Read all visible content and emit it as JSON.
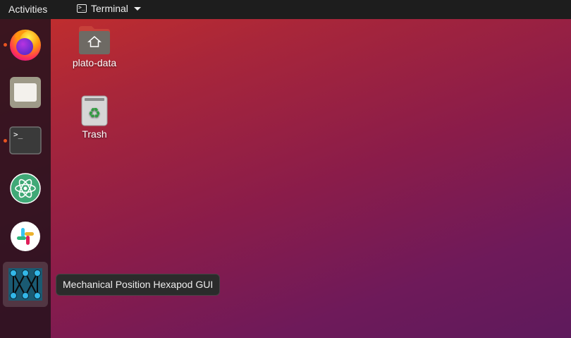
{
  "topbar": {
    "activities_label": "Activities",
    "app_menu_label": "Terminal"
  },
  "dock": {
    "items": [
      {
        "name": "firefox",
        "running": true
      },
      {
        "name": "files",
        "running": false
      },
      {
        "name": "terminal",
        "running": true
      },
      {
        "name": "atom",
        "running": false
      },
      {
        "name": "slack",
        "running": false
      },
      {
        "name": "mechanical-position-hexapod-gui",
        "running": false,
        "hovered": true
      }
    ],
    "running_indicator_color": "#e95420"
  },
  "desktop": {
    "icons": [
      {
        "label": "plato-data"
      },
      {
        "label": "Trash"
      }
    ]
  },
  "tooltip": {
    "text": "Mechanical Position Hexapod GUI"
  }
}
